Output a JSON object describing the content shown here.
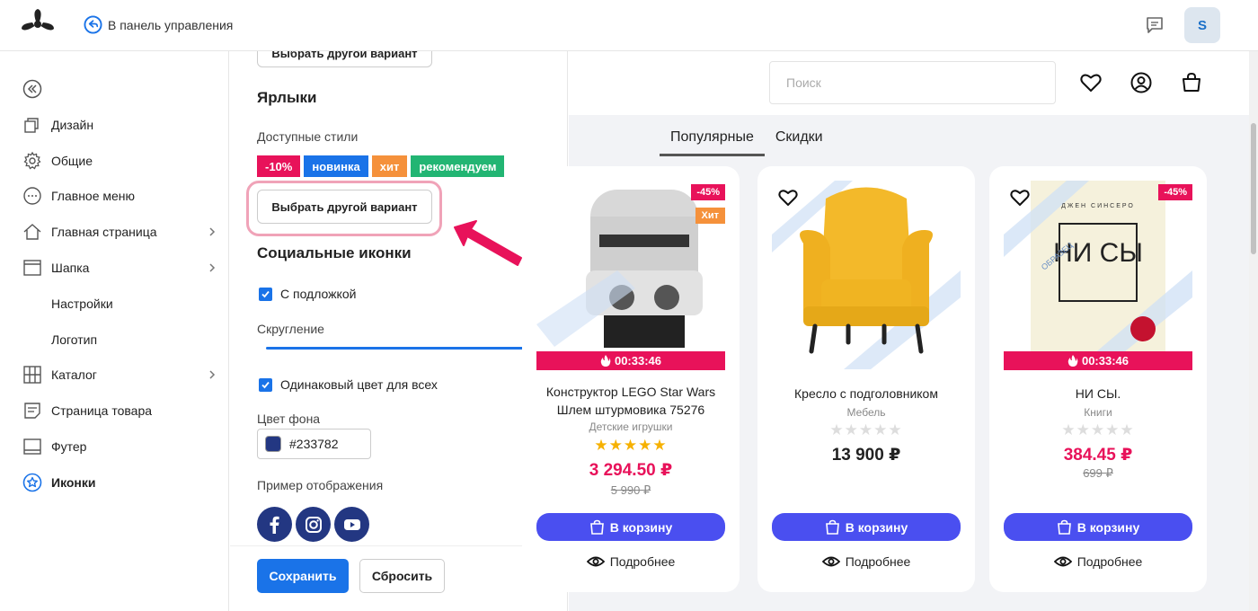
{
  "topbar": {
    "back_label": "В панель управления",
    "avatar_letter": "S"
  },
  "nav": {
    "items": [
      {
        "label": "Дизайн",
        "icon": "copy-icon"
      },
      {
        "label": "Общие",
        "icon": "gear-icon"
      },
      {
        "label": "Главное меню",
        "icon": "more-circle-icon"
      },
      {
        "label": "Главная страница",
        "icon": "home-icon"
      },
      {
        "label": "Шапка",
        "icon": "header-layout-icon"
      },
      {
        "label": "Настройки",
        "icon": ""
      },
      {
        "label": "Логотип",
        "icon": ""
      },
      {
        "label": "Каталог",
        "icon": "grid-icon"
      },
      {
        "label": "Страница товара",
        "icon": "document-icon"
      },
      {
        "label": "Футер",
        "icon": "footer-layout-icon"
      },
      {
        "label": "Иконки",
        "icon": "star-circle-icon"
      }
    ]
  },
  "panel": {
    "choose_other_label": "Выбрать другой вариант",
    "labels_heading": "Ярлыки",
    "available_styles_label": "Доступные стили",
    "badges": [
      {
        "text": "-10%",
        "color": "#e8125a"
      },
      {
        "text": "новинка",
        "color": "#1a73e8"
      },
      {
        "text": "хит",
        "color": "#f5913b"
      },
      {
        "text": "рекомендуем",
        "color": "#22b573"
      }
    ],
    "choose_other_label_2": "Выбрать другой вариант",
    "social_heading": "Социальные иконки",
    "with_background_label": "С подложкой",
    "rounding_label": "Скругление",
    "rounding_value": 1.0,
    "same_color_label": "Одинаковый цвет для всех",
    "bg_color_label": "Цвет фона",
    "bg_color_value": "#233782",
    "example_label": "Пример отображения",
    "socials": [
      "facebook-icon",
      "instagram-icon",
      "youtube-icon"
    ],
    "save_label": "Сохранить",
    "reset_label": "Сбросить"
  },
  "preview": {
    "search_placeholder": "Поиск",
    "tabs": [
      "Популярные",
      "Скидки"
    ],
    "products": [
      {
        "title": "Конструктор LEGO Star Wars Шлем штурмовика 75276",
        "category": "Детские игрушки",
        "rating": 5,
        "price": "3 294.50 ₽",
        "old_price": "5 990 ₽",
        "discount": "-45%",
        "hit": "Хит",
        "timer": "00:33:46",
        "cart_label": "В корзину",
        "more_label": "Подробнее"
      },
      {
        "title": "Кресло с подголовником",
        "category": "Мебель",
        "rating": 0,
        "price": "13 900 ₽",
        "cart_label": "В корзину",
        "more_label": "Подробнее"
      },
      {
        "title": "НИ СЫ.",
        "category": "Книги",
        "rating": 0,
        "price": "384.45 ₽",
        "old_price": "699 ₽",
        "discount": "-45%",
        "timer": "00:33:46",
        "cart_label": "В корзину",
        "more_label": "Подробнее",
        "cover_text": "НИ СЫ",
        "author": "ДЖЕН СИНСЕРО",
        "sample_mark": "ОБРАЗЕЦ"
      }
    ]
  },
  "colors": {
    "accent": "#1a73e8",
    "sale": "#e8125a",
    "cart": "#4a4ff0",
    "annotation": "#e8125a"
  }
}
